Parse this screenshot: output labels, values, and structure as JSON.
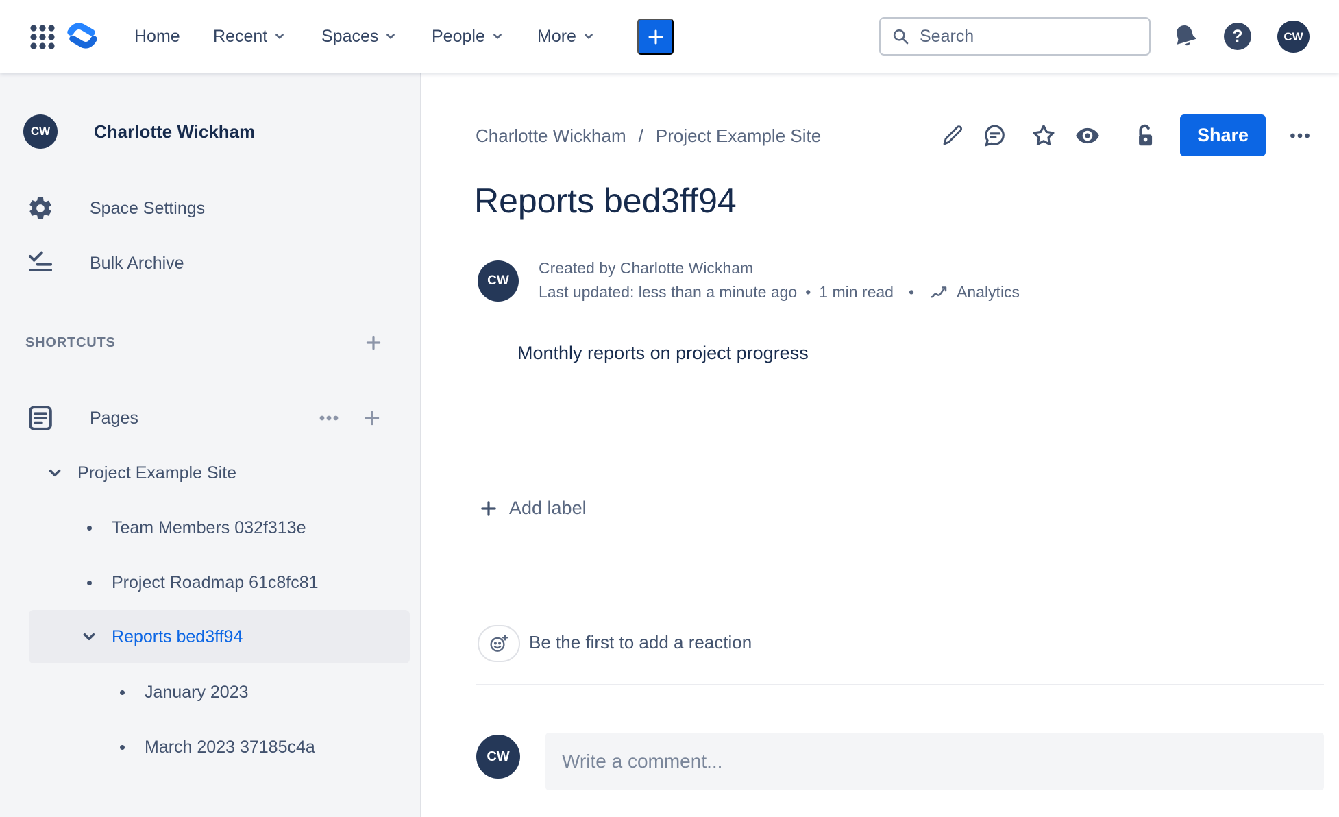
{
  "user": {
    "initials": "CW",
    "name": "Charlotte Wickham"
  },
  "colors": {
    "accent_blue": "#0C66E4",
    "navy_text": "#172B4D",
    "icon_navy": "#42526E",
    "gray_text": "#596780",
    "sidebar_bg": "#F4F5F7",
    "selected_bg": "#EBECF0",
    "border": "#DFE1E6",
    "avatar_bg": "#253858"
  },
  "topnav": {
    "menu": [
      {
        "label": "Home"
      },
      {
        "label": "Recent"
      },
      {
        "label": "Spaces"
      },
      {
        "label": "People"
      },
      {
        "label": "More"
      }
    ],
    "search_placeholder": "Search",
    "help_glyph": "?"
  },
  "sidebar": {
    "space_name": "Charlotte Wickham",
    "items": [
      {
        "label": "Space Settings"
      },
      {
        "label": "Bulk Archive"
      }
    ],
    "shortcuts_label": "SHORTCUTS",
    "pages_label": "Pages",
    "tree": [
      {
        "label": "Project Example Site"
      },
      {
        "label": "Team Members 032f313e"
      },
      {
        "label": "Project Roadmap 61c8fc81"
      },
      {
        "label": "Reports bed3ff94",
        "selected": true
      },
      {
        "label": "January 2023"
      },
      {
        "label": "March 2023 37185c4a"
      }
    ]
  },
  "content": {
    "breadcrumb": [
      {
        "label": "Charlotte Wickham"
      },
      {
        "label": "Project Example Site"
      }
    ],
    "breadcrumb_separator": "/",
    "share_label": "Share",
    "title": "Reports bed3ff94",
    "created_by": "Created by Charlotte Wickham",
    "last_updated": "Last updated: less than a minute ago",
    "dot_separator": "•",
    "read_time": "1 min read",
    "analytics_label": "Analytics",
    "body_text": "Monthly reports on project progress",
    "add_label_text": "Add label",
    "reaction_prompt": "Be the first to add a reaction",
    "comment_placeholder": "Write a comment..."
  }
}
